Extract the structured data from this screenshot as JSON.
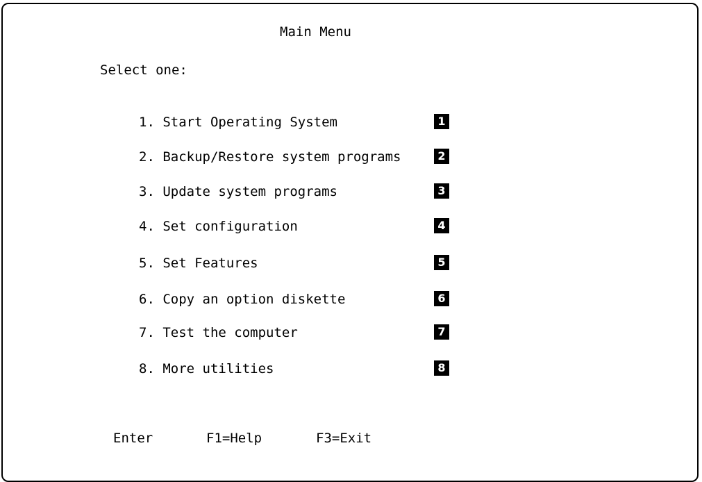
{
  "screen": {
    "title": "Main Menu",
    "prompt": "Select one:"
  },
  "menu": {
    "items": [
      {
        "label": "1. Start Operating System",
        "marker": "1"
      },
      {
        "label": "2. Backup/Restore system programs",
        "marker": "2"
      },
      {
        "label": "3. Update system programs",
        "marker": "3"
      },
      {
        "label": "4. Set configuration",
        "marker": "4"
      },
      {
        "label": "5. Set Features",
        "marker": "5"
      },
      {
        "label": "6. Copy an option diskette",
        "marker": "6"
      },
      {
        "label": "7. Test the computer",
        "marker": "7"
      },
      {
        "label": "8. More utilities",
        "marker": "8"
      }
    ]
  },
  "footer": {
    "enter": "Enter",
    "help": "F1=Help",
    "exit": "F3=Exit"
  }
}
